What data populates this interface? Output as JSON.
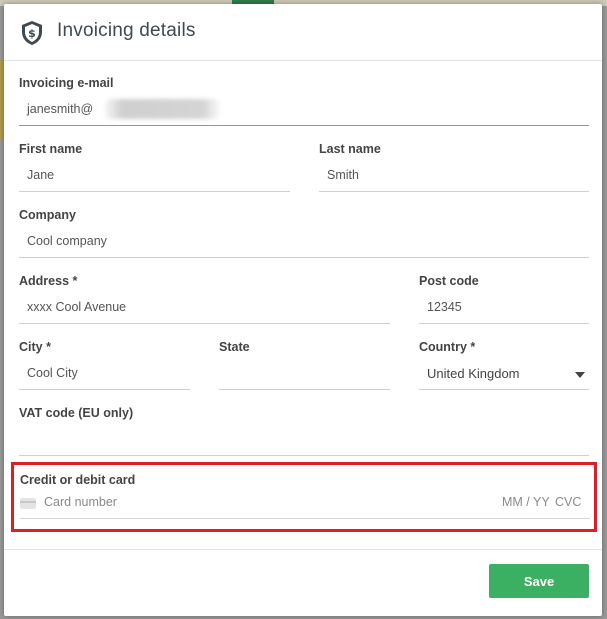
{
  "modal": {
    "title": "Invoicing details",
    "icon": "dollar-shield-icon"
  },
  "form": {
    "invoicing_email": {
      "label": "Invoicing e-mail",
      "value": "janesmith@"
    },
    "first_name": {
      "label": "First name",
      "value": "Jane"
    },
    "last_name": {
      "label": "Last name",
      "value": "Smith"
    },
    "company": {
      "label": "Company",
      "value": "Cool company"
    },
    "address": {
      "label": "Address *",
      "value": "xxxx Cool Avenue"
    },
    "post_code": {
      "label": "Post code",
      "value": "12345"
    },
    "city": {
      "label": "City *",
      "value": "Cool City"
    },
    "state": {
      "label": "State",
      "value": ""
    },
    "country": {
      "label": "Country *",
      "value": "United Kingdom"
    },
    "vat_code": {
      "label": "VAT code (EU only)",
      "value": ""
    }
  },
  "card": {
    "label": "Credit or debit card",
    "number_placeholder": "Card number",
    "expiry_placeholder": "MM / YY",
    "cvc_placeholder": "CVC",
    "icon": "credit-card-icon",
    "highlight_color": "#dd1f26"
  },
  "footer": {
    "save_label": "Save",
    "save_color": "#3bb062"
  }
}
